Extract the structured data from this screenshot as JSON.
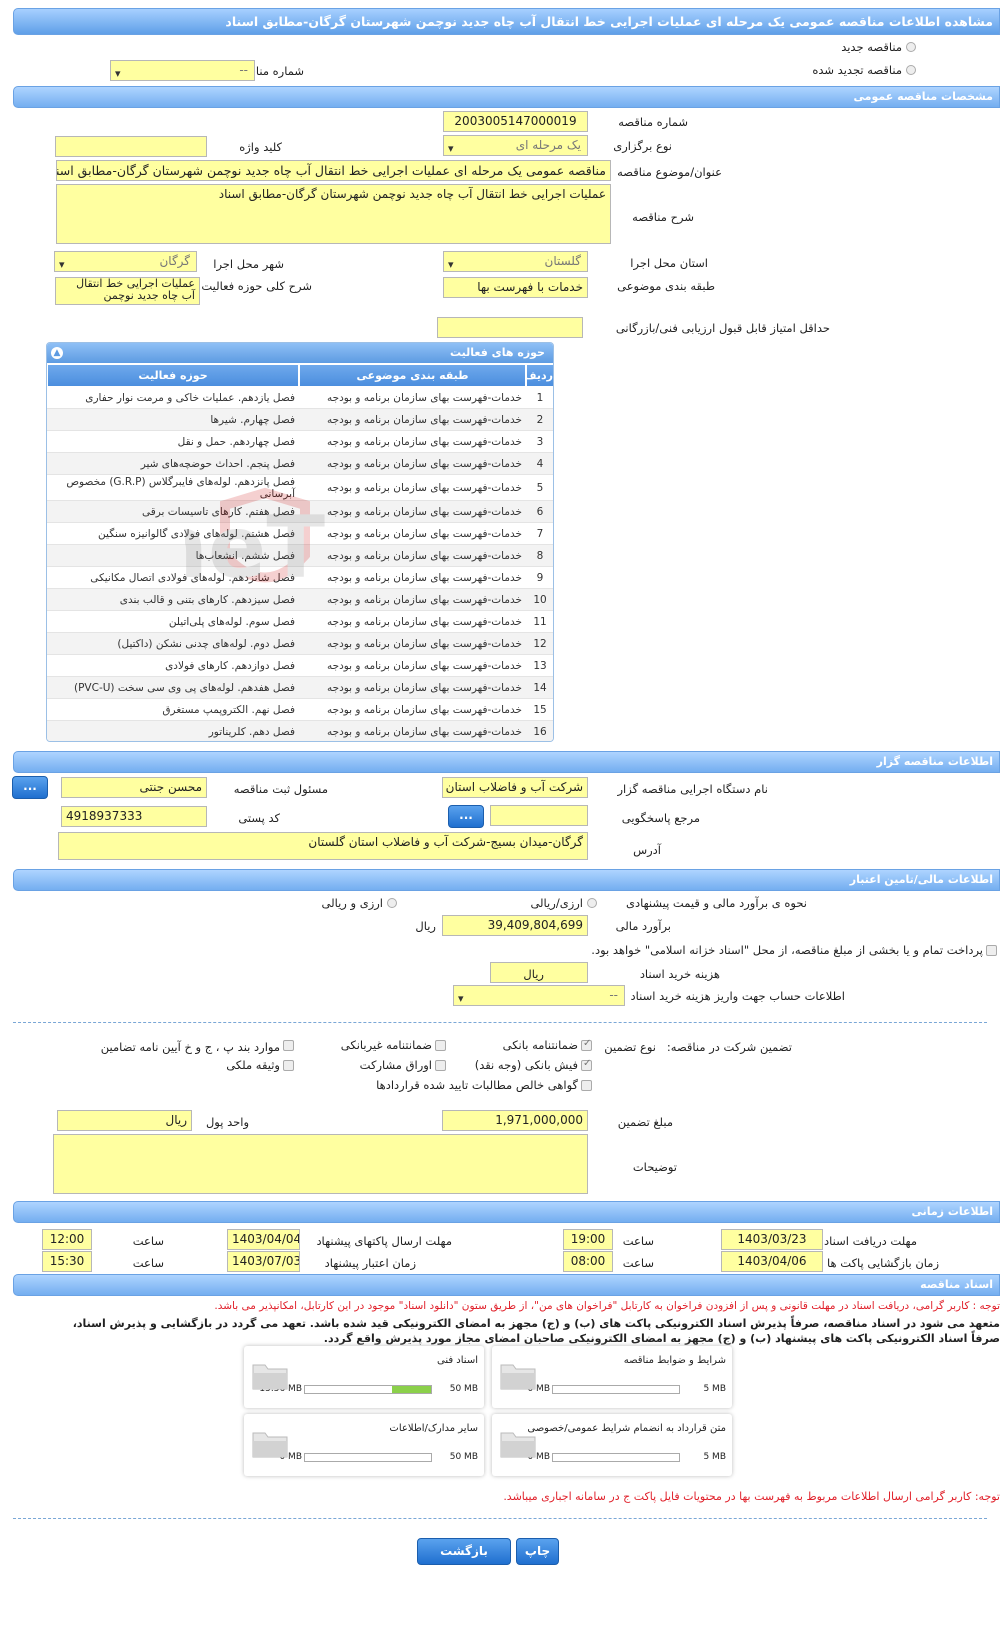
{
  "title": "مشاهده اطلاعات مناقصه عمومی یک مرحله ای عملیات اجرایی خط انتقال آب چاه جدید نوچمن شهرستان گرگان-مطابق اسناد",
  "tender_type": {
    "new": "مناقصه جدید",
    "renewed": "مناقصه تجدید شده",
    "prev_number_label": "شماره مناقصه قبلی",
    "prev_number_value": "--"
  },
  "general": {
    "header": "مشخصات مناقصه عمومی",
    "number_label": "شماره مناقصه",
    "number": "2003005147000019",
    "holding_type_label": "نوع برگزاری",
    "holding_type": "یک مرحله ای",
    "keyword_label": "کلید واژه",
    "keyword": "",
    "subject_label": "عنوان/موضوع مناقصه",
    "subject": "مناقصه عمومی یک مرحله ای عملیات اجرایی خط انتقال آب چاه جدید نوچمن شهرستان گرگان-مطابق اسناد",
    "description_label": "شرح مناقصه",
    "description": "عملیات اجرایی خط انتقال آب چاه جدید نوچمن شهرستان گرگان-مطابق اسناد",
    "province_label": "استان محل اجرا",
    "province": "گلستان",
    "city_label": "شهر محل اجرا",
    "city": "گرگان",
    "category_label": "طبقه بندی موضوعی",
    "category": "خدمات با فهرست بها",
    "activity_label": "شرح کلی حوزه فعالیت",
    "activity": "عملیات اجرایی خط انتقال آب چاه جدید نوچمن",
    "min_score_label": "حداقل امتیاز قابل قبول ارزیابی فنی/بازرگانی",
    "min_score": ""
  },
  "activities": {
    "title": "حوزه های فعالیت",
    "columns": [
      "ردیف",
      "طبقه بندی موضوعی",
      "حوزه فعالیت"
    ],
    "rows": [
      [
        "1",
        "خدمات-فهرست بهای سازمان برنامه و بودجه",
        "فصل یازدهم. عملیات خاکی و مرمت نوار حفاری"
      ],
      [
        "2",
        "خدمات-فهرست بهای سازمان برنامه و بودجه",
        "فصل چهارم. شیرها"
      ],
      [
        "3",
        "خدمات-فهرست بهای سازمان برنامه و بودجه",
        "فصل چهاردهم. حمل و نقل"
      ],
      [
        "4",
        "خدمات-فهرست بهای سازمان برنامه و بودجه",
        "فصل پنجم. احداث حوضچه‌های شیر"
      ],
      [
        "5",
        "خدمات-فهرست بهای سازمان برنامه و بودجه",
        "فصل پانزدهم. لوله‌های فایبرگلاس (G.R.P) مخصوص آبرسانی"
      ],
      [
        "6",
        "خدمات-فهرست بهای سازمان برنامه و بودجه",
        "فصل هفتم. کارهای تاسیسات برقی"
      ],
      [
        "7",
        "خدمات-فهرست بهای سازمان برنامه و بودجه",
        "فصل هشتم. لوله‌های فولادی گالوانیزه سنگین"
      ],
      [
        "8",
        "خدمات-فهرست بهای سازمان برنامه و بودجه",
        "فصل ششم. انشعاب‌ها"
      ],
      [
        "9",
        "خدمات-فهرست بهای سازمان برنامه و بودجه",
        "فصل شانزدهم. لوله‌های فولادی اتصال مکانیکی"
      ],
      [
        "10",
        "خدمات-فهرست بهای سازمان برنامه و بودجه",
        "فصل سیزدهم. کارهای بتنی و قالب بندی"
      ],
      [
        "11",
        "خدمات-فهرست بهای سازمان برنامه و بودجه",
        "فصل سوم. لوله‌های پلی‌اتیلن"
      ],
      [
        "12",
        "خدمات-فهرست بهای سازمان برنامه و بودجه",
        "فصل دوم. لوله‌های چدنی نشکن (داکتیل)"
      ],
      [
        "13",
        "خدمات-فهرست بهای سازمان برنامه و بودجه",
        "فصل دوازدهم. کارهای فولادی"
      ],
      [
        "14",
        "خدمات-فهرست بهای سازمان برنامه و بودجه",
        "فصل هفدهم. لوله‌های پی وی سی سخت (PVC-U)"
      ],
      [
        "15",
        "خدمات-فهرست بهای سازمان برنامه و بودجه",
        "فصل نهم. الکتروپمپ مستغرق"
      ],
      [
        "16",
        "خدمات-فهرست بهای سازمان برنامه و بودجه",
        "فصل دهم. کلریناتور"
      ]
    ]
  },
  "organizer": {
    "header": "اطلاعات مناقصه گزار",
    "org_label": "نام دستگاه اجرایی مناقصه گزار",
    "org": "شرکت آب و فاضلاب استان",
    "resp_label": "مسئول ثبت مناقصه",
    "resp": "محسن جنتی",
    "ref_label": "مرجع پاسخگویی",
    "ref": "",
    "postal_label": "کد پستی",
    "postal": "4918937333",
    "address_label": "آدرس",
    "address": "گرگان-میدان بسیج-شرکت آب و فاضلاب استان گلستان",
    "more_btn": "..."
  },
  "finance": {
    "header": "اطلاعات مالی/تامین اعتبار",
    "method_label": "نحوه ی برآورد مالی و قیمت پیشنهادی",
    "opt1": "ارزی/ریالی",
    "opt2": "ارزی و ریالی",
    "estimate_label": "برآورد مالی",
    "estimate": "39,409,804,699",
    "unit": "ریال",
    "treasury_text": "پرداخت تمام و یا بخشی از مبلغ مناقصه، از محل \"اسناد خزانه اسلامی\" خواهد بود.",
    "doc_cost_label": "هزینه خرید اسناد",
    "doc_cost": "",
    "doc_cost_unit": "ریال",
    "account_label": "اطلاعات حساب جهت واریز هزینه خرید اسناد",
    "account": "--"
  },
  "guarantee": {
    "participation_label": "تضمین شرکت در مناقصه:",
    "type_label": "نوع تضمین",
    "opts": [
      "ضمانتنامه بانکی",
      "ضمانتنامه غیربانکی",
      "موارد بند پ ، ج و خ آیین نامه تضامین",
      "فیش بانکی (وجه نقد)",
      "اوراق مشارکت",
      "وثیقه ملکی",
      "گواهی خالص مطالبات تایید شده قراردادها"
    ],
    "amount_label": "مبلغ تضمین",
    "amount": "1,971,000,000",
    "currency_label": "واحد پول",
    "currency": "ریال",
    "notes_label": "توضیحات",
    "notes": ""
  },
  "timing": {
    "header": "اطلاعات زمانی",
    "doc_receive_label": "مهلت دریافت اسناد",
    "doc_receive_date": "1403/03/23",
    "doc_receive_time": "19:00",
    "send_label": "مهلت ارسال پاکتهای پیشنهاد",
    "send_date": "1403/04/04",
    "send_time": "12:00",
    "open_label": "زمان بازگشایی پاکت ها",
    "open_date": "1403/04/06",
    "open_time": "08:00",
    "valid_label": "زمان اعتبار پیشنهاد",
    "valid_date": "1403/07/03",
    "valid_time": "15:30",
    "time_label": "ساعت"
  },
  "docs": {
    "header": "اسناد مناقصه",
    "note1": "توجه : کاربر گرامی، دریافت اسناد در مهلت قانونی و پس از افزودن فراخوان به کارتابل \"فراخوان های من\"، از طریق ستون \"دانلود اسناد\" موجود در این کارتابل، امکانپذیر می باشد.",
    "commit1": "متعهد می شود در اسناد مناقصه، صرفاً پذیرش اسناد الکترونیکی پاکت های (ب) و (ج) مجهز به امضای الکترونیکی قید شده باشد. تعهد می گردد در بازگشایی و پذیرش اسناد،",
    "commit2": "صرفاً اسناد الکترونیکی پاکت های پیشنهاد (ب) و (ج) مجهز به امضای الکترونیکی صاحبان امضای مجاز مورد پذیرش واقع گردد.",
    "files": [
      {
        "name": "شرایط و ضوابط مناقصه",
        "current": "0 MB",
        "max": "5 MB",
        "progress": 0
      },
      {
        "name": "اسناد فنی",
        "current": "15.56 MB",
        "max": "50 MB",
        "progress": 0.311
      },
      {
        "name": "متن قرارداد به انضمام شرایط عمومی/خصوصی",
        "current": "0 MB",
        "max": "5 MB",
        "progress": 0
      },
      {
        "name": "سایر مدارک/اطلاعات",
        "current": "0 MB",
        "max": "50 MB",
        "progress": 0
      }
    ],
    "note2": "توجه: کاربر گرامی ارسال اطلاعات مربوط به فهرست بها در محتویات فایل پاکت ج در سامانه اجباری میباشد."
  },
  "buttons": {
    "back": "بازگشت",
    "print": "چاپ"
  }
}
